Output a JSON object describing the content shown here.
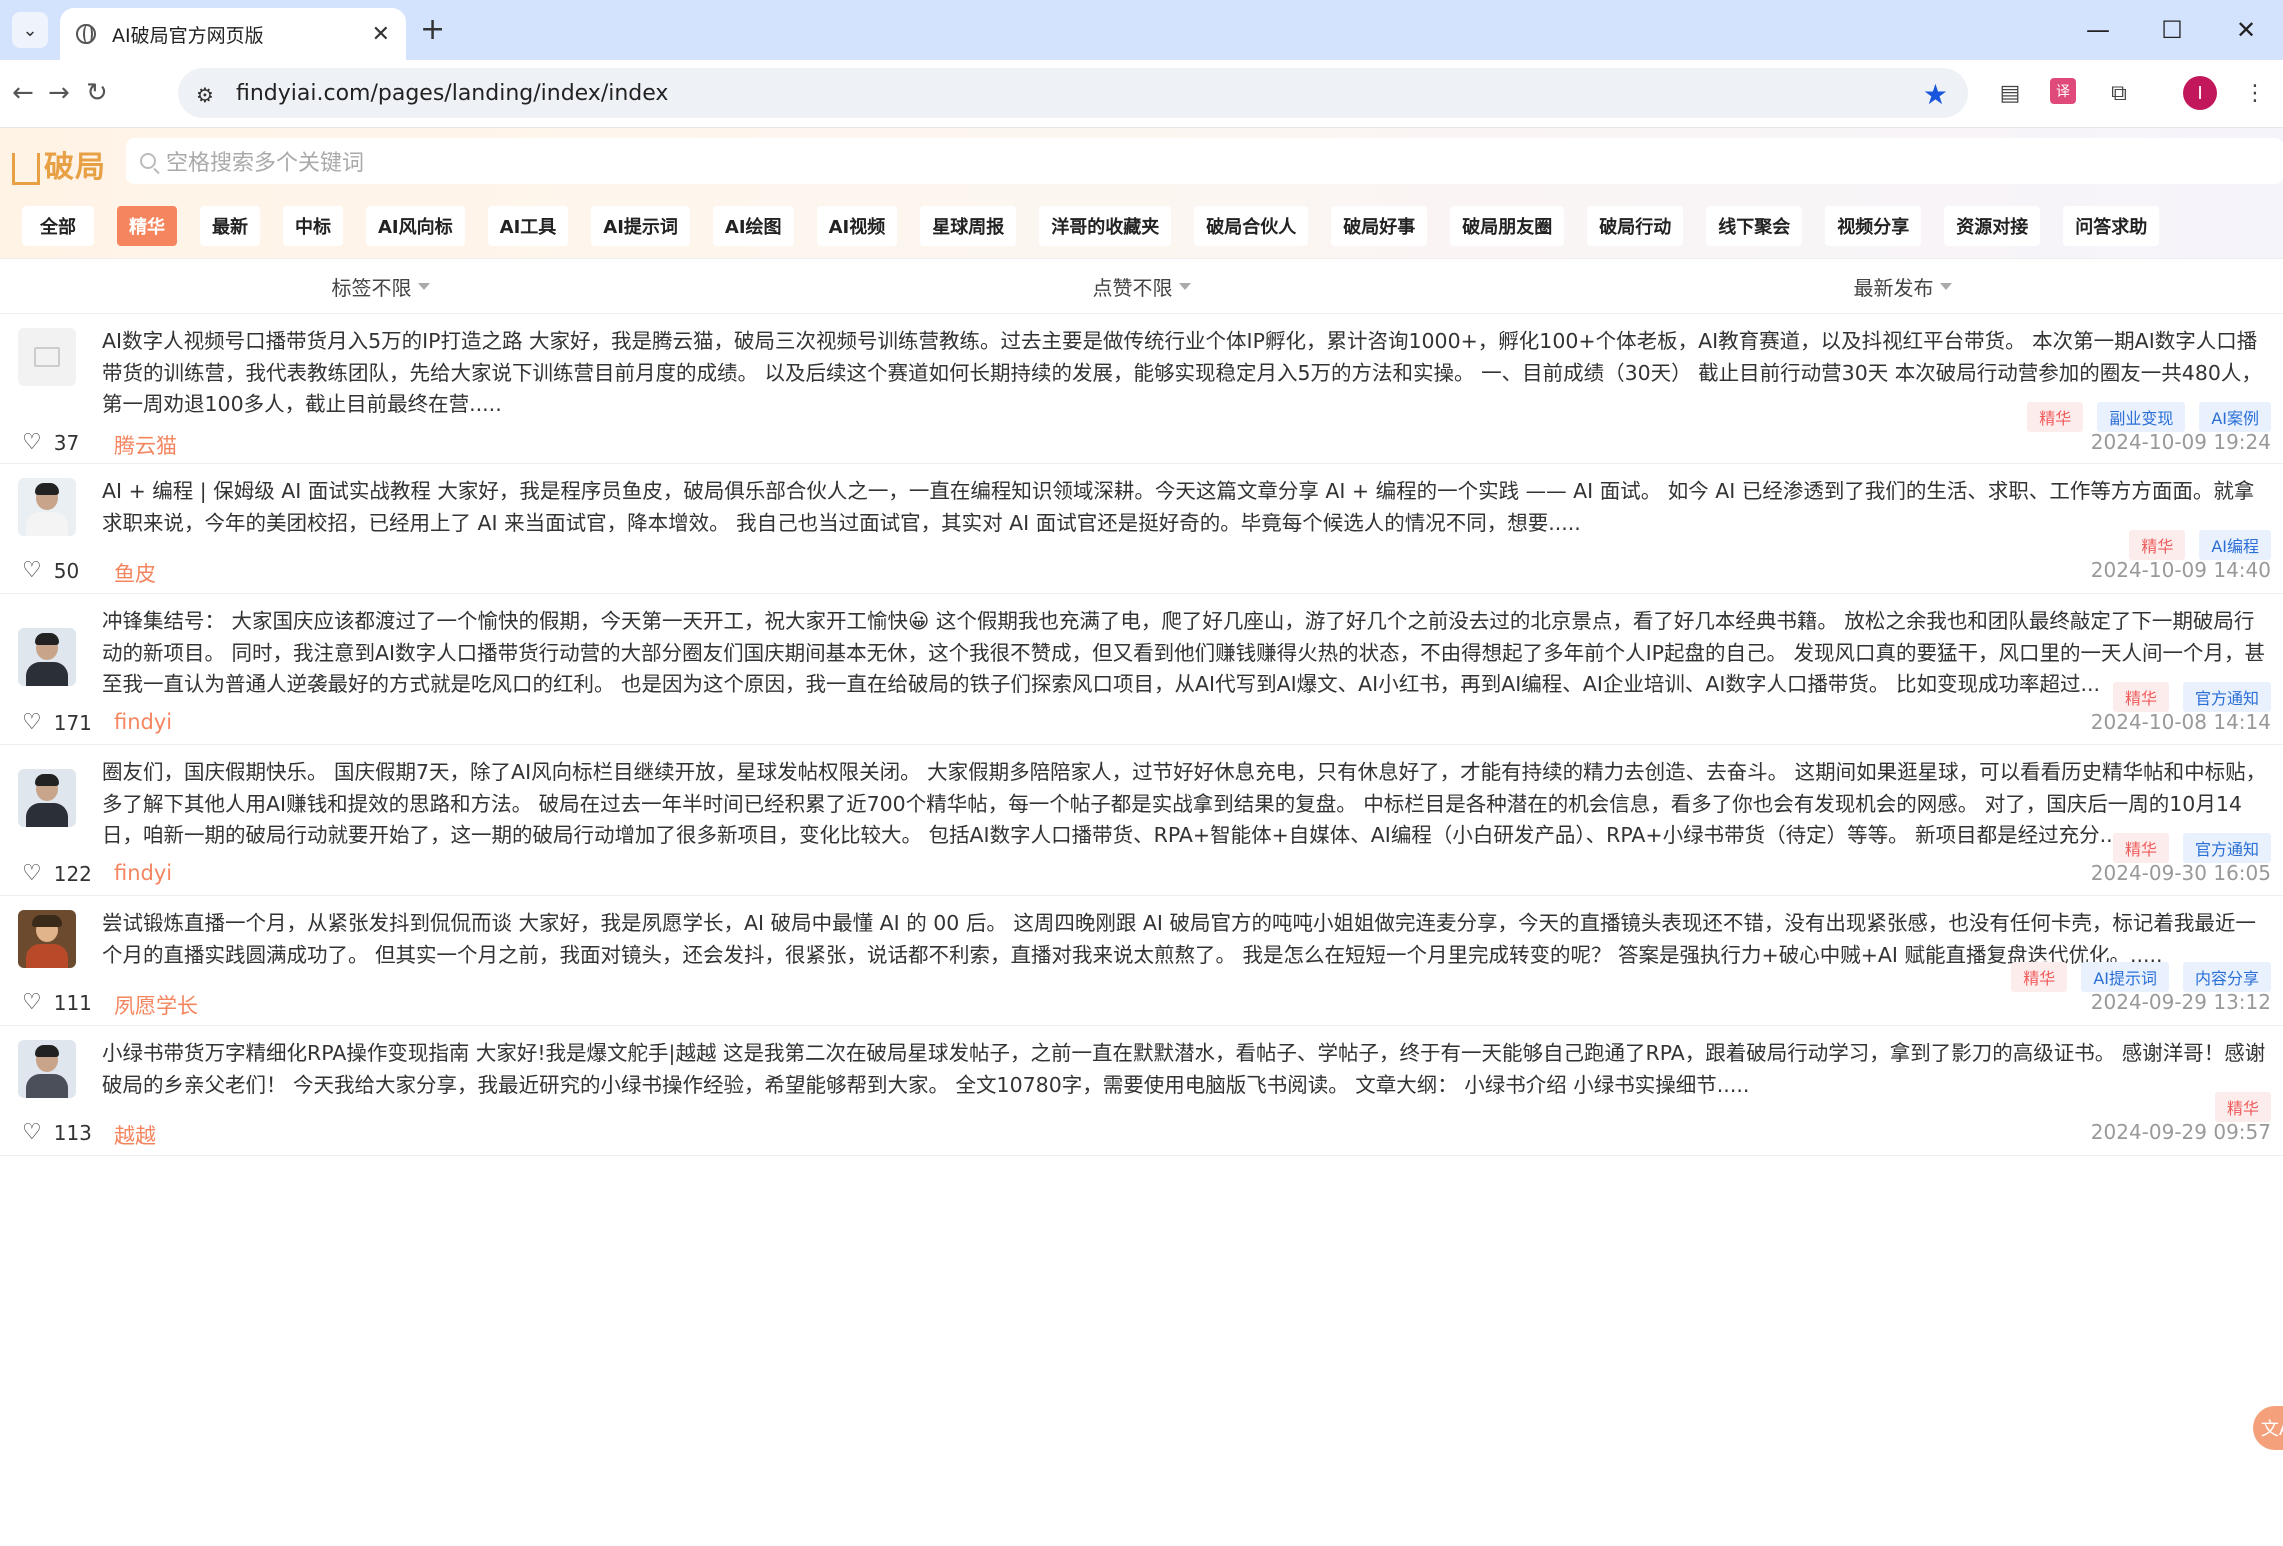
{
  "browser": {
    "tab_title": "AI破局官方网页版",
    "url": "findyiai.com/pages/landing/index/index",
    "profile_initial": "I"
  },
  "header": {
    "logo_text": "破局",
    "search_placeholder": "空格搜索多个关键词"
  },
  "categories": [
    {
      "label": "全部",
      "active": false
    },
    {
      "label": "精华",
      "active": true
    },
    {
      "label": "最新",
      "active": false
    },
    {
      "label": "中标",
      "active": false
    },
    {
      "label": "AI风向标",
      "active": false
    },
    {
      "label": "AI工具",
      "active": false
    },
    {
      "label": "AI提示词",
      "active": false
    },
    {
      "label": "AI绘图",
      "active": false
    },
    {
      "label": "AI视频",
      "active": false
    },
    {
      "label": "星球周报",
      "active": false
    },
    {
      "label": "洋哥的收藏夹",
      "active": false
    },
    {
      "label": "破局合伙人",
      "active": false
    },
    {
      "label": "破局好事",
      "active": false
    },
    {
      "label": "破局朋友圈",
      "active": false
    },
    {
      "label": "破局行动",
      "active": false
    },
    {
      "label": "线下聚会",
      "active": false
    },
    {
      "label": "视频分享",
      "active": false
    },
    {
      "label": "资源对接",
      "active": false
    },
    {
      "label": "问答求助",
      "active": false
    }
  ],
  "filters": {
    "tag": "标签不限",
    "likes": "点赞不限",
    "sort": "最新发布"
  },
  "posts": [
    {
      "text": "AI数字人视频号口播带货月入5万的IP打造之路 大家好，我是腾云猫，破局三次视频号训练营教练。过去主要是做传统行业个体IP孵化，累计咨询1000+，孵化100+个体老板，AI教育赛道，以及抖视红平台带货。 本次第一期AI数字人口播带货的训练营，我代表教练团队，先给大家说下训练营目前月度的成绩。 以及后续这个赛道如何长期持续的发展，能够实现稳定月入5万的方法和实操。 一、目前成绩（30天） 截止目前行动营30天 本次破局行动营参加的圈友一共480人，第一周劝退100多人，截止目前最终在营.....",
      "tags": [
        "精华",
        "副业变现",
        "AI案例"
      ],
      "likes": "37",
      "author": "腾云猫",
      "date": "2024-10-09 19:24",
      "avatar": "placeholder-image-icon"
    },
    {
      "text": "AI + 编程 | 保姆级 AI 面试实战教程 大家好，我是程序员鱼皮，破局俱乐部合伙人之一，一直在编程知识领域深耕。今天这篇文章分享 AI + 编程的一个实践 —— AI 面试。 如今 AI 已经渗透到了我们的生活、求职、工作等方方面面。就拿求职来说，今年的美团校招，已经用上了 AI 来当面试官，降本增效。 我自己也当过面试官，其实对 AI 面试官还是挺好奇的。毕竟每个候选人的情况不同，想要.....",
      "tags": [
        "精华",
        "AI编程"
      ],
      "likes": "50",
      "author": "鱼皮",
      "date": "2024-10-09 14:40",
      "avatar": "white"
    },
    {
      "text": "冲锋集结号： 大家国庆应该都渡过了一个愉快的假期，今天第一天开工，祝大家开工愉快😀 这个假期我也充满了电，爬了好几座山，游了好几个之前没去过的北京景点，看了好几本经典书籍。 放松之余我也和团队最终敲定了下一期破局行动的新项目。 同时，我注意到AI数字人口播带货行动营的大部分圈友们国庆期间基本无休，这个我很不赞成，但又看到他们赚钱赚得火热的状态，不由得想起了多年前个人IP起盘的自己。 发现风口真的要猛干，风口里的一天人间一个月，甚至我一直认为普通人逆袭最好的方式就是吃风口的红利。 也是因为这个原因，我一直在给破局的铁子们探索风口项目，从AI代写到AI爆文、AI小红书，再到AI编程、AI企业培训、AI数字人口播带货。 比如变现成功率超过...",
      "tags": [
        "精华",
        "官方通知"
      ],
      "likes": "171",
      "author": "findyi",
      "date": "2024-10-08 14:14",
      "avatar": "dark"
    },
    {
      "text": "圈友们，国庆假期快乐。 国庆假期7天，除了AI风向标栏目继续开放，星球发帖权限关闭。 大家假期多陪陪家人，过节好好休息充电，只有休息好了，才能有持续的精力去创造、去奋斗。 这期间如果逛星球，可以看看历史精华帖和中标贴，多了解下其他人用AI赚钱和提效的思路和方法。 破局在过去一年半时间已经积累了近700个精华帖，每一个帖子都是实战拿到结果的复盘。 中标栏目是各种潜在的机会信息，看多了你也会有发现机会的网感。 对了，国庆后一周的10月14日，咱新一期的破局行动就要开始了，这一期的破局行动增加了很多新项目，变化比较大。 包括AI数字人口播带货、RPA+智能体+自媒体、AI编程（小白研发产品）、RPA+小绿书带货（待定）等等。 新项目都是经过充分...",
      "tags": [
        "精华",
        "官方通知"
      ],
      "likes": "122",
      "author": "findyi",
      "date": "2024-09-30 16:05",
      "avatar": "dark"
    },
    {
      "text": "尝试锻炼直播一个月，从紧张发抖到侃侃而谈 大家好，我是夙愿学长，AI 破局中最懂 AI 的 00 后。 这周四晚刚跟 AI 破局官方的吨吨小姐姐做完连麦分享，今天的直播镜头表现还不错，没有出现紧张感，也没有任何卡壳，标记着我最近一个月的直播实践圆满成功了。 但其实一个月之前，我面对镜头，还会发抖，很紧张，说话都不利索，直播对我来说太煎熬了。 我是怎么在短短一个月里完成转变的呢？ 答案是强执行力+破心中贼+AI 赋能直播复盘迭代优化。.....",
      "tags": [
        "精华",
        "AI提示词",
        "内容分享"
      ],
      "likes": "111",
      "author": "夙愿学长",
      "date": "2024-09-29 13:12",
      "avatar": "art"
    },
    {
      "text": "小绿书带货万字精细化RPA操作变现指南 大家好!我是爆文舵手|越越 这是我第二次在破局星球发帖子，之前一直在默默潜水，看帖子、学帖子，终于有一天能够自己跑通了RPA，跟着破局行动学习，拿到了影刀的高级证书。 感谢洋哥！感谢破局的乡亲父老们！ 今天我给大家分享，我最近研究的小绿书操作经验，希望能够帮到大家。 全文10780字，需要使用电脑版飞书阅读。 文章大纲： 小绿书介绍 小绿书实操细节.....",
      "tags": [
        "精华"
      ],
      "likes": "113",
      "author": "越越",
      "date": "2024-09-29 09:57",
      "avatar": "grey"
    }
  ],
  "side_fab_label": "文A"
}
